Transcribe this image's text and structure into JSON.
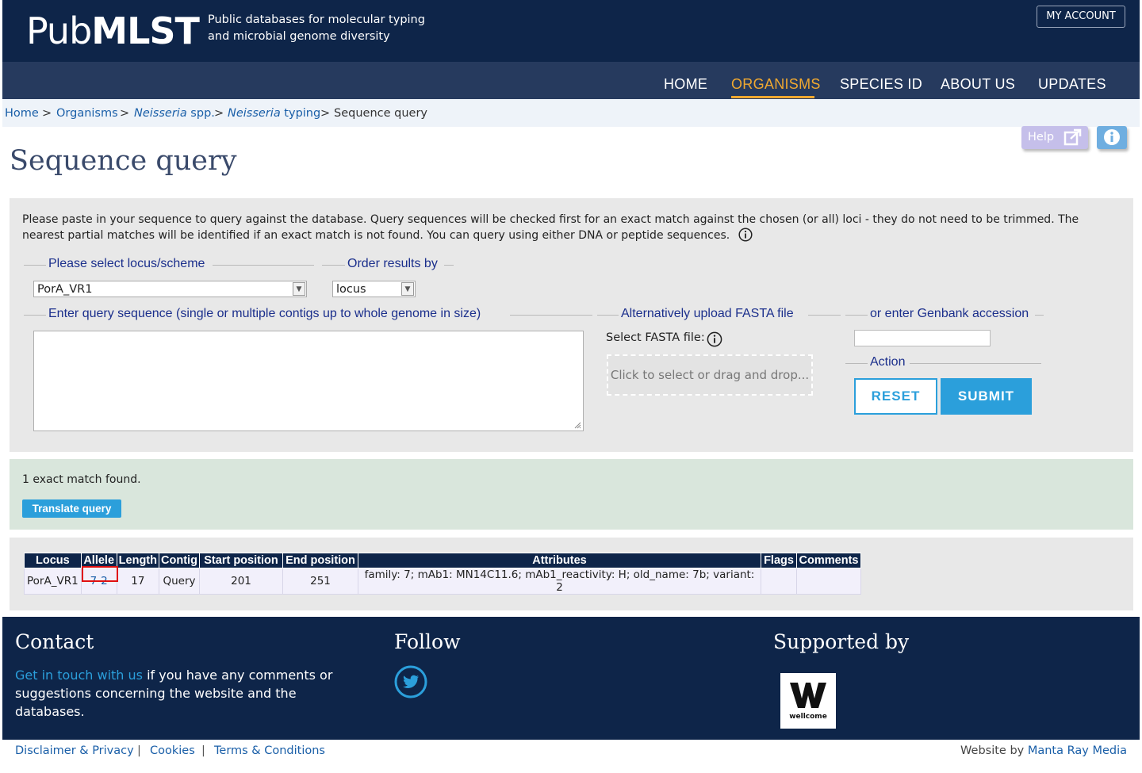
{
  "header": {
    "logo_light": "Pub",
    "logo_bold": "MLST",
    "tagline_line1": "Public databases for molecular typing",
    "tagline_line2": "and microbial genome diversity",
    "my_account": "MY ACCOUNT",
    "nav": [
      "HOME",
      "ORGANISMS",
      "SPECIES ID",
      "ABOUT US",
      "UPDATES"
    ],
    "active_nav": "ORGANISMS"
  },
  "breadcrumb": {
    "home": "Home",
    "organisms": "Organisms",
    "neisseria_italic": "Neisseria",
    "spp": " spp.",
    "typing_italic": "Neisseria",
    "typing": " typing",
    "current": "Sequence query",
    "sep": ">"
  },
  "page": {
    "title": "Sequence query",
    "help_label": "Help"
  },
  "query": {
    "intro": "Please paste in your sequence to query against the database. Query sequences will be checked first for an exact match against the chosen (or all) loci - they do not need to be trimmed. The nearest partial matches will be identified if an exact match is not found. You can query using either DNA or peptide sequences.",
    "locus_legend": "Please select locus/scheme",
    "locus_value": "PorA_VR1",
    "order_legend": "Order results by",
    "order_value": "locus",
    "sequence_legend": "Enter query sequence (single or multiple contigs up to whole genome in size)",
    "fasta_legend": "Alternatively upload FASTA file",
    "fasta_label": "Select FASTA file:",
    "dropzone_text": "Click to select or drag and drop...",
    "genbank_legend": "or enter Genbank accession",
    "action_legend": "Action",
    "reset_label": "RESET",
    "submit_label": "SUBMIT"
  },
  "results": {
    "summary": "1 exact match found.",
    "translate_label": "Translate query",
    "columns": [
      "Locus",
      "Allele",
      "Length",
      "Contig",
      "Start position",
      "End position",
      "Attributes",
      "Flags",
      "Comments"
    ],
    "row": {
      "locus": "PorA_VR1",
      "allele": "7-2",
      "length": "17",
      "contig": "Query",
      "start": "201",
      "end": "251",
      "attributes": "family: 7; mAb1: MN14C11.6; mAb1_reactivity: H; old_name: 7b; variant: 2",
      "flags": "",
      "comments": ""
    }
  },
  "footer": {
    "contact_heading": "Contact",
    "contact_link": "Get in touch with us",
    "contact_text": " if you have any comments or suggestions concerning the website and the databases.",
    "follow_heading": "Follow",
    "supported_heading": "Supported by",
    "wellcome_text": "wellcome",
    "links": [
      "Disclaimer & Privacy",
      "Cookies",
      "Terms & Conditions"
    ],
    "link_sep": "|",
    "credit_prefix": "Website by ",
    "credit_link": "Manta Ray Media"
  },
  "colors": {
    "navy": "#0e2549",
    "accent_orange": "#f0a830",
    "button_blue": "#2b9fdb",
    "highlight_red": "#e01010"
  },
  "icons": [
    "external-link-icon",
    "info-icon",
    "twitter-icon",
    "wellcome-logo-icon"
  ]
}
